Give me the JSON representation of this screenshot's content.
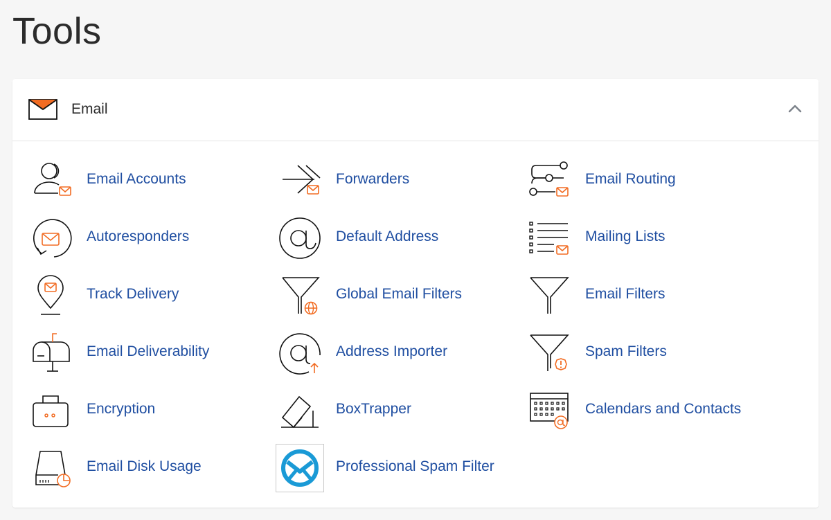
{
  "page": {
    "title": "Tools"
  },
  "section": {
    "label": "Email",
    "collapse_icon": "chevron-up-icon"
  },
  "colors": {
    "accent": "#f26c23",
    "link": "#1f4ea1",
    "icon_stroke": "#111111",
    "spam_logo": "#1a9ad6"
  },
  "tools": [
    {
      "label": "Email Accounts",
      "icon": "user-mail-icon"
    },
    {
      "label": "Forwarders",
      "icon": "forward-arrow-icon"
    },
    {
      "label": "Email Routing",
      "icon": "routing-icon"
    },
    {
      "label": "Autoresponders",
      "icon": "autoresponder-icon"
    },
    {
      "label": "Default Address",
      "icon": "at-sign-icon"
    },
    {
      "label": "Mailing Lists",
      "icon": "list-mail-icon"
    },
    {
      "label": "Track Delivery",
      "icon": "location-pin-icon"
    },
    {
      "label": "Global Email Filters",
      "icon": "filter-globe-icon"
    },
    {
      "label": "Email Filters",
      "icon": "filter-icon"
    },
    {
      "label": "Email Deliverability",
      "icon": "mailbox-icon"
    },
    {
      "label": "Address Importer",
      "icon": "at-import-icon"
    },
    {
      "label": "Spam Filters",
      "icon": "filter-warning-icon"
    },
    {
      "label": "Encryption",
      "icon": "lock-icon"
    },
    {
      "label": "BoxTrapper",
      "icon": "boxtrapper-icon"
    },
    {
      "label": "Calendars and Contacts",
      "icon": "calendar-at-icon"
    },
    {
      "label": "Email Disk Usage",
      "icon": "disk-usage-icon"
    },
    {
      "label": "Professional Spam Filter",
      "icon": "spam-experts-logo-icon"
    }
  ]
}
